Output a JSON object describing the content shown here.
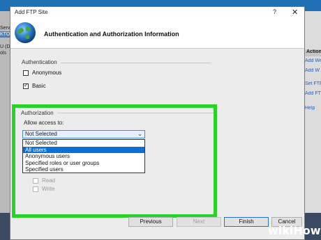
{
  "background": {
    "left_items": [
      "Servi",
      "KTO",
      "",
      "U (D",
      "ols"
    ],
    "right_header": "Actions",
    "right_links": [
      "Add We",
      "Add W",
      "Set FTP",
      "Add FTP",
      "Help"
    ]
  },
  "dialog": {
    "title": "Add FTP Site",
    "help_glyph": "?",
    "close_glyph": "✕",
    "header_title": "Authentication and Authorization Information",
    "authentication": {
      "legend": "Authentication",
      "anonymous_label": "Anonymous",
      "anonymous_checked": false,
      "basic_label": "Basic",
      "basic_checked": true
    },
    "authorization": {
      "legend": "Authorization",
      "allow_label": "Allow access to:",
      "selected_value": "Not Selected",
      "options": [
        "Not Selected",
        "All users",
        "Anonymous users",
        "Specified roles or user groups",
        "Specified users"
      ],
      "highlighted_option": "All users",
      "permissions": {
        "read_label": "Read",
        "write_label": "Write"
      }
    },
    "buttons": {
      "previous": "Previous",
      "next": "Next",
      "finish": "Finish",
      "cancel": "Cancel"
    }
  },
  "watermark": "wikiHow",
  "colors": {
    "highlight_box": "#2bd12b",
    "selection_blue": "#0a6fd6"
  }
}
